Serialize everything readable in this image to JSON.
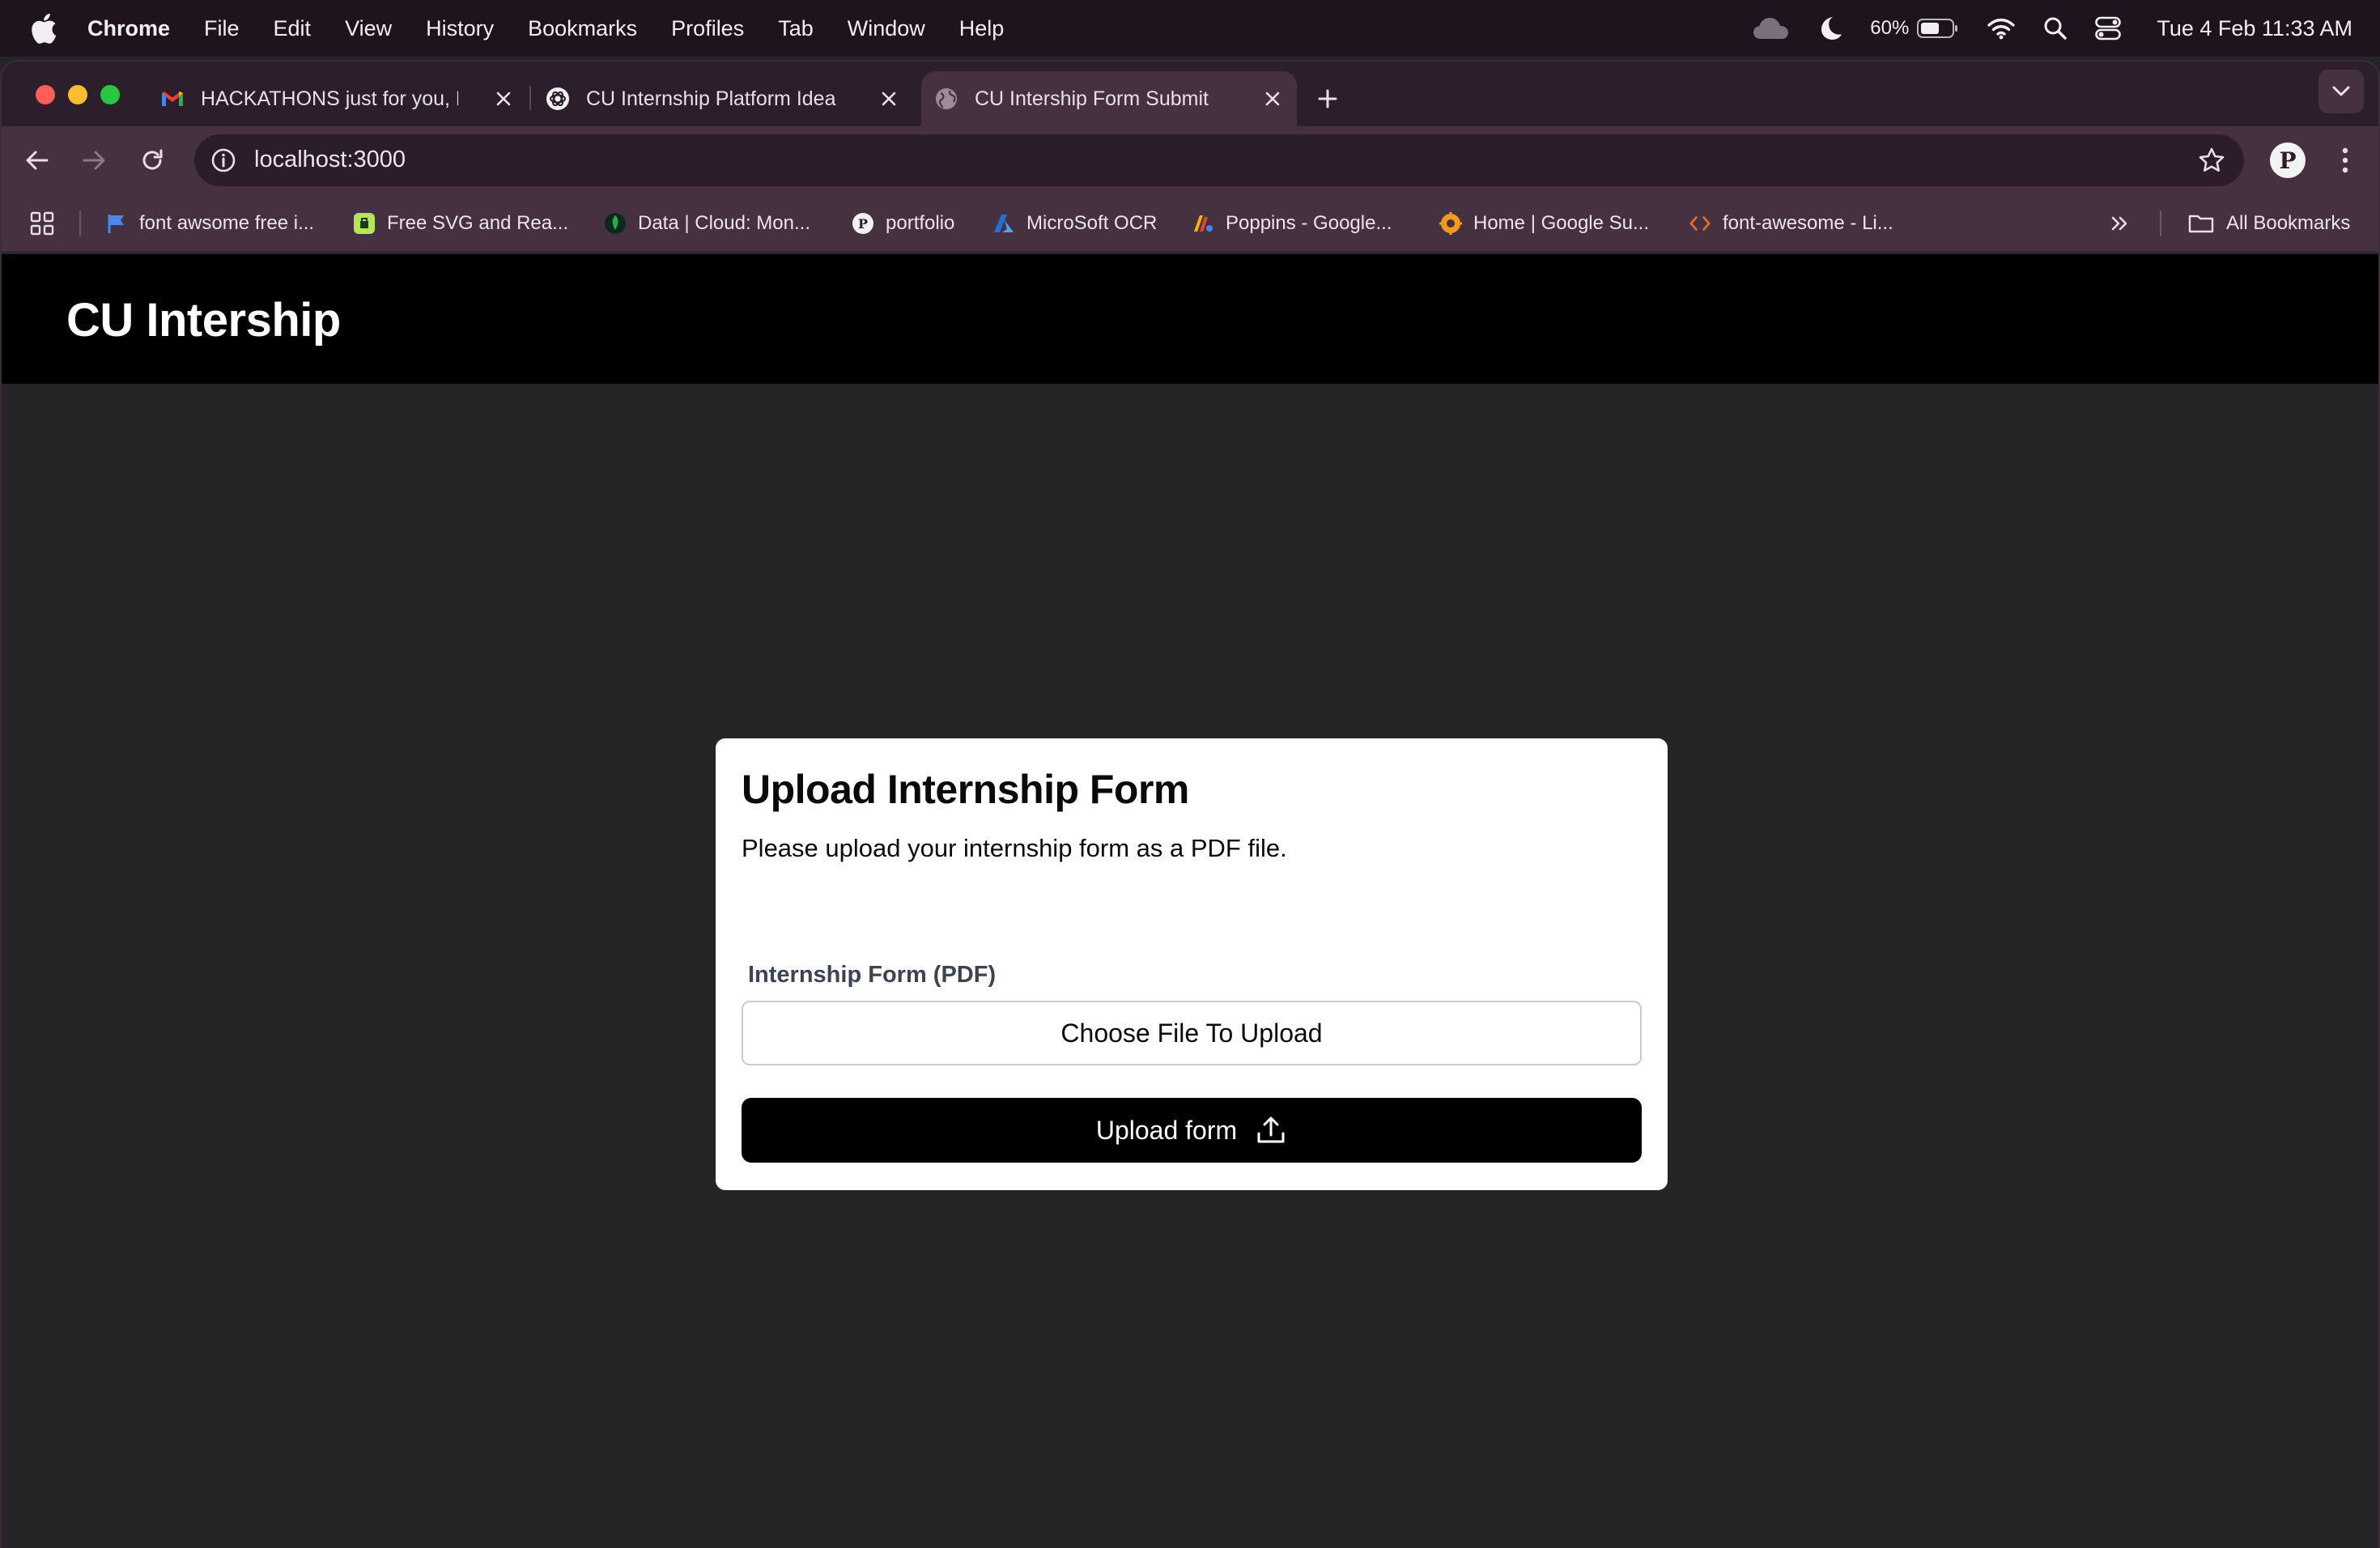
{
  "menubar": {
    "app_name": "Chrome",
    "items": [
      "File",
      "Edit",
      "View",
      "History",
      "Bookmarks",
      "Profiles",
      "Tab",
      "Window",
      "Help"
    ],
    "battery": "60%",
    "clock": "Tue 4 Feb  11:33 AM"
  },
  "tabs": [
    {
      "title": "HACKATHONS just for you, Pi",
      "icon": "gmail-icon",
      "active": false
    },
    {
      "title": "CU Internship Platform Idea",
      "icon": "chatgpt-icon",
      "active": false
    },
    {
      "title": "CU Intership Form Submit",
      "icon": "globe-icon",
      "active": true
    }
  ],
  "address_bar": {
    "url": "localhost:3000"
  },
  "bookmarks": [
    {
      "label": "font awsome free i...",
      "icon": "flag-icon"
    },
    {
      "label": "Free SVG and Rea...",
      "icon": "svg-repo-icon"
    },
    {
      "label": "Data | Cloud: Mon...",
      "icon": "mongodb-leaf-icon"
    },
    {
      "label": "portfolio",
      "icon": "portfolio-avatar-icon"
    },
    {
      "label": "MicroSoft OCR",
      "icon": "azure-icon"
    },
    {
      "label": "Poppins - Google...",
      "icon": "google-fonts-icon"
    },
    {
      "label": "Home | Google Su...",
      "icon": "google-support-icon"
    },
    {
      "label": "font-awesome - Li...",
      "icon": "code-icon"
    }
  ],
  "all_bookmarks_label": "All Bookmarks",
  "profile_initial": "P",
  "site": {
    "brand": "CU Intership"
  },
  "form": {
    "title": "Upload Internship Form",
    "description": "Please upload your internship form as a PDF file.",
    "field_label": "Internship Form (PDF)",
    "file_button": "Choose File To Upload",
    "submit_label": "Upload form"
  },
  "colors": {
    "menubar_bg": "#1d141d",
    "tabstrip_bg": "#2d1e2c",
    "toolbar_bg": "#45313f",
    "page_bg": "#252527",
    "header_bg": "#000000",
    "card_bg": "#ffffff",
    "button_bg": "#000000"
  }
}
